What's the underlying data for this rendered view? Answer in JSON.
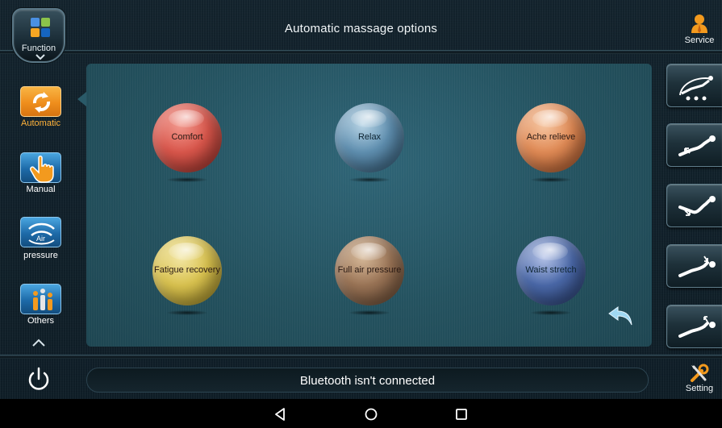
{
  "header": {
    "title": "Automatic massage options",
    "function_label": "Function",
    "service_label": "Service"
  },
  "sidebar": {
    "items": [
      {
        "label": "Automatic",
        "icon": "auto-cycle-icon",
        "active": true
      },
      {
        "label": "Manual",
        "icon": "hand-pointer-icon",
        "active": false
      },
      {
        "label": "Air pressure",
        "icon_text": "Air",
        "label_line2": "pressure",
        "icon": "air-pressure-icon",
        "active": false
      },
      {
        "label": "Others",
        "icon": "people-icon",
        "active": false
      }
    ]
  },
  "options": [
    {
      "label": "Comfort",
      "color": "#d9564b"
    },
    {
      "label": "Relax",
      "color": "#5f8fb0"
    },
    {
      "label": "Ache relieve",
      "color": "#e08a55"
    },
    {
      "label": "Fatigue recovery",
      "color": "#d9c24f"
    },
    {
      "label": "Full air pressure",
      "color": "#9a7456"
    },
    {
      "label": "Waist stretch",
      "color": "#4a68a8"
    }
  ],
  "presets": [
    {
      "icon": "zero-gravity-icon"
    },
    {
      "icon": "recline-up-left-icon"
    },
    {
      "icon": "recline-down-right-icon"
    },
    {
      "icon": "recline-down-up-icon"
    },
    {
      "icon": "recline-up-icon"
    }
  ],
  "status": {
    "text": "Bluetooth isn't connected"
  },
  "setting_label": "Setting",
  "colors": {
    "accent_orange": "#ffb23a",
    "sidebar_blue": "#1d6aa8",
    "panel_teal": "#24525f"
  }
}
